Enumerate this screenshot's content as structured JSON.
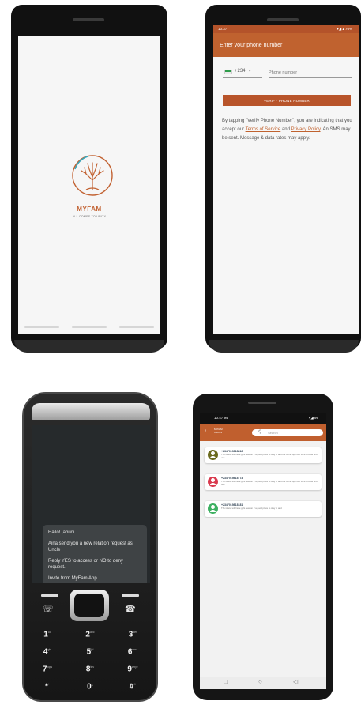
{
  "splash": {
    "logo_icon": "family-tree-icon",
    "brand": "MYFAM",
    "tagline": "ALL COMES TO UNITY"
  },
  "phone_screen": {
    "status_time": "10:37",
    "status_icons": "▾◢ ▴ 76%",
    "title": "Enter your phone number",
    "country_flag_icon": "nigeria-flag-icon",
    "country_code": "+234",
    "phone_placeholder": "Phone number",
    "verify_button": "VERIFY PHONE NUMBER",
    "terms": {
      "pre": "By tapping \"Verify Phone Number\", you are indicating that you accept our ",
      "tos": "Terms of Service",
      "mid": " and ",
      "privacy": "Privacy Policy",
      "post": ". An SMS may be sent. Message & data rates may apply."
    }
  },
  "feature_phone": {
    "sms_greeting": "Hallo! ,abudi",
    "sms_body": "Aina send you a new relation request as Uncle",
    "sms_reply": "Reply YES to access or NO to deny request.",
    "sms_footer": "Invite from MyFam App",
    "keys": [
      {
        "main": "1",
        "sub": "oo"
      },
      {
        "main": "2",
        "sub": "abc"
      },
      {
        "main": "3",
        "sub": "def"
      },
      {
        "main": "4",
        "sub": "ghi"
      },
      {
        "main": "5",
        "sub": "jkl"
      },
      {
        "main": "6",
        "sub": "mno"
      },
      {
        "main": "7",
        "sub": "pqrs"
      },
      {
        "main": "8",
        "sub": "tuv"
      },
      {
        "main": "9",
        "sub": "wxyz"
      },
      {
        "main": "*",
        "sub": "+"
      },
      {
        "main": "0",
        "sub": "␣"
      },
      {
        "main": "#",
        "sub": "⇧"
      }
    ]
  },
  "chats_screen": {
    "status_time": "10:47 94",
    "status_icons": "▾◢ 99",
    "bar_title_line1": "MYFAM",
    "bar_title_line2": "CHATS",
    "search_placeholder": "Search",
    "chats": [
      {
        "name": "+2347019818812",
        "message": "The island will have girls season 2 a good place to stay in and out of the App use PASSCODE and use",
        "color": "#6b6b1f"
      },
      {
        "name": "+2347019818773",
        "message": "The island will have girls season 2 a good place to stay in and out of the App use PASSCODE and use",
        "color": "#d93a4e"
      },
      {
        "name": "+2347019818181",
        "message": "The island will have girls season 2 a good place to stay in and",
        "color": "#3db061"
      }
    ],
    "nav": {
      "back": "◁",
      "home": "○",
      "recents": "□"
    }
  },
  "colors": {
    "brand": "#c0622f",
    "status_bar": "#b4532a"
  }
}
